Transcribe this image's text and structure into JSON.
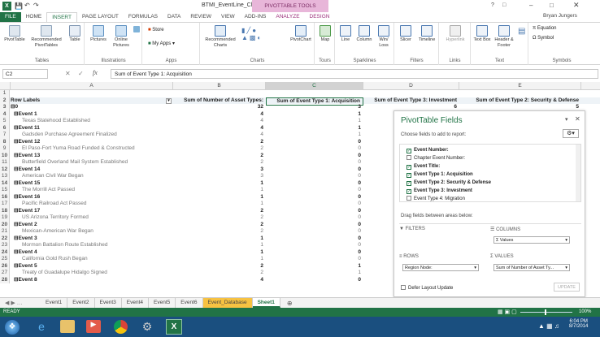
{
  "window": {
    "title": "BTMI_EventLine_Chapter_One_Integrated - Excel",
    "context_tab_group": "PIVOTTABLE TOOLS",
    "user": "Bryan Jungers",
    "help": "?"
  },
  "ribbon_tabs": [
    "FILE",
    "HOME",
    "INSERT",
    "PAGE LAYOUT",
    "FORMULAS",
    "DATA",
    "REVIEW",
    "VIEW",
    "ADD-INS",
    "ANALYZE",
    "DESIGN"
  ],
  "ribbon": {
    "tables": {
      "label": "Tables",
      "pivottable": "PivotTable",
      "recommended": "Recommended PivotTables",
      "table": "Table"
    },
    "illustrations": {
      "label": "Illustrations",
      "pictures": "Pictures",
      "online": "Online Pictures"
    },
    "apps": {
      "label": "Apps",
      "store": "Store",
      "myapps": "My Apps"
    },
    "charts": {
      "label": "Charts",
      "recommended": "Recommended Charts",
      "pivotchart": "PivotChart"
    },
    "tours": {
      "label": "Tours",
      "map": "Map"
    },
    "sparklines": {
      "label": "Sparklines",
      "line": "Line",
      "column": "Column",
      "winloss": "Win/ Loss"
    },
    "filters": {
      "label": "Filters",
      "slicer": "Slicer",
      "timeline": "Timeline"
    },
    "links": {
      "label": "Links",
      "hyperlink": "Hyperlink"
    },
    "text": {
      "label": "Text",
      "textbox": "Text Box",
      "headerfooter": "Header & Footer"
    },
    "symbols": {
      "label": "Symbols",
      "equation": "Equation",
      "symbol": "Symbol"
    }
  },
  "formula_bar": {
    "name_box": "C2",
    "fx": "fx",
    "content": "Sum of Event Type 1: Acquisition"
  },
  "columns": [
    "A",
    "B",
    "C",
    "D",
    "E"
  ],
  "header_row": {
    "row": "2",
    "a": "Row Labels",
    "b": "Sum of Number of Asset Types:",
    "c": "Sum of Event Type 1: Acquisition",
    "d": "Sum of Event Type 3: Investment",
    "e": "Sum of Event Type 2: Security & Defense"
  },
  "rows": [
    {
      "n": "1",
      "a": "",
      "b": "",
      "c": "",
      "d": "",
      "e": "",
      "kind": "blank"
    },
    {
      "n": "3",
      "a": "⊟0",
      "b": "32",
      "c": "3",
      "d": "6",
      "e": "5",
      "kind": "bold"
    },
    {
      "n": "4",
      "a": "⊟Event 1",
      "b": "4",
      "c": "1",
      "d": "",
      "e": "",
      "kind": "ev"
    },
    {
      "n": "5",
      "a": "Texas Statehood Established",
      "b": "4",
      "c": "1",
      "d": "",
      "e": "",
      "kind": "sub"
    },
    {
      "n": "6",
      "a": "⊟Event 11",
      "b": "4",
      "c": "1",
      "d": "",
      "e": "",
      "kind": "ev"
    },
    {
      "n": "7",
      "a": "Gadsden Purchase Agreement Finalized",
      "b": "4",
      "c": "1",
      "d": "",
      "e": "",
      "kind": "sub"
    },
    {
      "n": "8",
      "a": "⊟Event 12",
      "b": "2",
      "c": "0",
      "d": "",
      "e": "",
      "kind": "ev"
    },
    {
      "n": "9",
      "a": "El Paso-Fort Yuma Road Funded & Constructed",
      "b": "2",
      "c": "0",
      "d": "",
      "e": "",
      "kind": "sub"
    },
    {
      "n": "10",
      "a": "⊟Event 13",
      "b": "2",
      "c": "0",
      "d": "",
      "e": "",
      "kind": "ev"
    },
    {
      "n": "11",
      "a": "Butterfield Overland Mail System Established",
      "b": "2",
      "c": "0",
      "d": "",
      "e": "",
      "kind": "sub"
    },
    {
      "n": "12",
      "a": "⊟Event 14",
      "b": "3",
      "c": "0",
      "d": "",
      "e": "",
      "kind": "ev"
    },
    {
      "n": "13",
      "a": "American Civil War Began",
      "b": "3",
      "c": "0",
      "d": "",
      "e": "",
      "kind": "sub"
    },
    {
      "n": "14",
      "a": "⊟Event 15",
      "b": "1",
      "c": "0",
      "d": "",
      "e": "",
      "kind": "ev"
    },
    {
      "n": "15",
      "a": "The Morrill Act Passed",
      "b": "1",
      "c": "0",
      "d": "",
      "e": "",
      "kind": "sub"
    },
    {
      "n": "16",
      "a": "⊟Event 16",
      "b": "1",
      "c": "0",
      "d": "",
      "e": "",
      "kind": "ev"
    },
    {
      "n": "17",
      "a": "Pacific Railroad Act Passed",
      "b": "1",
      "c": "0",
      "d": "",
      "e": "",
      "kind": "sub"
    },
    {
      "n": "18",
      "a": "⊟Event 17",
      "b": "2",
      "c": "0",
      "d": "",
      "e": "",
      "kind": "ev"
    },
    {
      "n": "19",
      "a": "US Arizona Territory Formed",
      "b": "2",
      "c": "0",
      "d": "",
      "e": "",
      "kind": "sub"
    },
    {
      "n": "20",
      "a": "⊟Event 2",
      "b": "2",
      "c": "0",
      "d": "",
      "e": "",
      "kind": "ev"
    },
    {
      "n": "21",
      "a": "Mexican-American War Began",
      "b": "2",
      "c": "0",
      "d": "",
      "e": "",
      "kind": "sub"
    },
    {
      "n": "22",
      "a": "⊟Event 3",
      "b": "1",
      "c": "0",
      "d": "",
      "e": "",
      "kind": "ev"
    },
    {
      "n": "23",
      "a": "Mormon Battalion Route Established",
      "b": "1",
      "c": "0",
      "d": "",
      "e": "",
      "kind": "sub"
    },
    {
      "n": "24",
      "a": "⊟Event 4",
      "b": "1",
      "c": "0",
      "d": "",
      "e": "",
      "kind": "ev"
    },
    {
      "n": "25",
      "a": "California Gold Rush Began",
      "b": "1",
      "c": "0",
      "d": "",
      "e": "",
      "kind": "sub"
    },
    {
      "n": "26",
      "a": "⊟Event 5",
      "b": "2",
      "c": "1",
      "d": "",
      "e": "",
      "kind": "ev"
    },
    {
      "n": "27",
      "a": "Treaty of Guadalupe Hidalgo Signed",
      "b": "2",
      "c": "1",
      "d": "",
      "e": "",
      "kind": "sub"
    },
    {
      "n": "28",
      "a": "⊟Event 8",
      "b": "4",
      "c": "0",
      "d": "",
      "e": "",
      "kind": "ev"
    }
  ],
  "pivot_pane": {
    "title": "PivotTable Fields",
    "choose": "Choose fields to add to report:",
    "fields": [
      {
        "label": "Event Number:",
        "checked": true
      },
      {
        "label": "Chapter Event Number:",
        "checked": false
      },
      {
        "label": "Event Title:",
        "checked": true
      },
      {
        "label": "Event Type 1: Acquisition",
        "checked": true
      },
      {
        "label": "Event Type 2: Security & Defense",
        "checked": true
      },
      {
        "label": "Event Type 3: Investment",
        "checked": true
      },
      {
        "label": "Event Type 4: Migration",
        "checked": false
      }
    ],
    "drag": "Drag fields between areas below:",
    "filters": "FILTERS",
    "columns": "COLUMNS",
    "columns_value": "Σ Values",
    "rows": "ROWS",
    "rows_value": "Region Node:",
    "values": "VALUES",
    "values_value": "Sum of Number of Asset Ty...",
    "defer": "Defer Layout Update",
    "update": "UPDATE"
  },
  "sheet_tabs": [
    "Event1",
    "Event2",
    "Event3",
    "Event4",
    "Event5",
    "Event6",
    "Event_Database",
    "Sheet1"
  ],
  "status": {
    "ready": "READY",
    "zoom": "100%"
  },
  "clock": {
    "time": "6:04 PM",
    "date": "8/7/2014"
  }
}
